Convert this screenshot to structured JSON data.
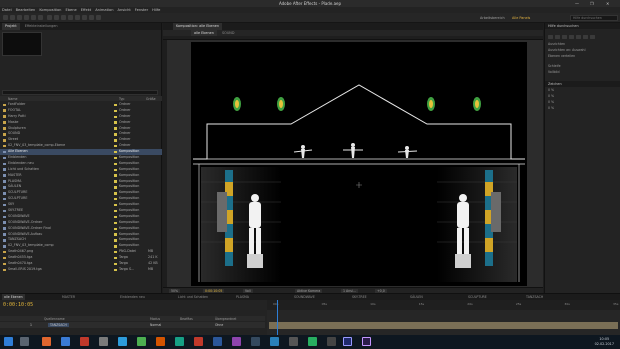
{
  "window": {
    "title": "Adobe After Effects - Plade.aep",
    "controls": [
      "—",
      "❐",
      "✕"
    ]
  },
  "menu": [
    "Datei",
    "Bearbeiten",
    "Komposition",
    "Ebene",
    "Effekt",
    "Animation",
    "Ansicht",
    "Fenster",
    "Hilfe"
  ],
  "toolbar": {
    "workspaces": [
      "Arbeitsbereich",
      "Alle Panels"
    ],
    "active_workspace": "Alle Panels",
    "search_placeholder": "Hilfe durchsuchen"
  },
  "project": {
    "tabs": [
      "Projekt",
      "Effekteinstellungen"
    ],
    "columns": {
      "name": "Name",
      "type": "Typ",
      "size": "Größe"
    },
    "items": [
      {
        "name": "FontFolder",
        "type": "Ordner",
        "size": "",
        "kind": "folder"
      },
      {
        "name": "FOOTAL",
        "type": "Ordner",
        "size": "",
        "kind": "folder"
      },
      {
        "name": "Harry Potti",
        "type": "Ordner",
        "size": "",
        "kind": "folder"
      },
      {
        "name": "Maske",
        "type": "Ordner",
        "size": "",
        "kind": "folder"
      },
      {
        "name": "Skulpturen",
        "type": "Ordner",
        "size": "",
        "kind": "folder"
      },
      {
        "name": "SOUND",
        "type": "Ordner",
        "size": "",
        "kind": "folder"
      },
      {
        "name": "Street",
        "type": "Ordner",
        "size": "",
        "kind": "folder"
      },
      {
        "name": "02_FNV_03_template_comp-Ebene",
        "type": "Ordner",
        "size": "",
        "kind": "folder"
      },
      {
        "name": "Alle Ebenen",
        "type": "Komposition",
        "size": "",
        "kind": "comp"
      },
      {
        "name": "Einblenden",
        "type": "Komposition",
        "size": "",
        "kind": "comp"
      },
      {
        "name": "Einblenden neu",
        "type": "Komposition",
        "size": "",
        "kind": "comp"
      },
      {
        "name": "Licht und Schatten",
        "type": "Komposition",
        "size": "",
        "kind": "comp"
      },
      {
        "name": "MASTER",
        "type": "Komposition",
        "size": "",
        "kind": "comp"
      },
      {
        "name": "PLASMA",
        "type": "Komposition",
        "size": "",
        "kind": "comp"
      },
      {
        "name": "SÄULEN",
        "type": "Komposition",
        "size": "",
        "kind": "comp"
      },
      {
        "name": "SCULPTURE",
        "type": "Komposition",
        "size": "",
        "kind": "comp"
      },
      {
        "name": "SCULPTURE",
        "type": "Komposition",
        "size": "",
        "kind": "comp"
      },
      {
        "name": "SKY",
        "type": "Komposition",
        "size": "",
        "kind": "comp"
      },
      {
        "name": "SKY-TREE",
        "type": "Komposition",
        "size": "",
        "kind": "comp"
      },
      {
        "name": "SOUNDWAVE",
        "type": "Komposition",
        "size": "",
        "kind": "comp"
      },
      {
        "name": "SOUNDWAVE-Ordner",
        "type": "Komposition",
        "size": "",
        "kind": "comp"
      },
      {
        "name": "SOUNDWAVE-Ordner Final",
        "type": "Komposition",
        "size": "",
        "kind": "comp"
      },
      {
        "name": "SOUNDWAVE-Aufbau",
        "type": "Komposition",
        "size": "",
        "kind": "comp"
      },
      {
        "name": "TANZSACH",
        "type": "Komposition",
        "size": "",
        "kind": "comp"
      },
      {
        "name": "02_FNV_03_template_comp",
        "type": "Komposition",
        "size": "",
        "kind": "comp"
      },
      {
        "name": "Seath0467.png",
        "type": "PNG-Datei",
        "size": "MB",
        "kind": "file"
      },
      {
        "name": "Seath0455.tga",
        "type": "Targa",
        "size": "241 K",
        "kind": "file"
      },
      {
        "name": "Seath0470.tga",
        "type": "Targa",
        "size": "42 KB",
        "kind": "file"
      },
      {
        "name": "Small-ERIS 2019.tga",
        "type": "Targa S...",
        "size": "MB",
        "kind": "file"
      }
    ],
    "selected_index": 8
  },
  "composition": {
    "panel_title": "Komposition: alle Ebenen",
    "tabs": [
      "alle Ebenen",
      "SOUND"
    ],
    "zoom": "50%",
    "timecode": "0:00:10:05",
    "resolution": "Voll",
    "camera": "Aktive Kamera",
    "views": "1 Ansi...",
    "offset": "+0,0"
  },
  "right_panels": {
    "top_title": "Hilfe durchsuchen",
    "info_rows": [
      "Ausrichten",
      "Ausrichten an: Auswahl",
      "Ebenen verteilen"
    ],
    "preview_title": "Vorschau",
    "preview_options": [
      "Schleife",
      "Vollbild"
    ],
    "character_title": "Zeichen",
    "character_values": [
      "0 %",
      "0 %",
      "0 %",
      "0 %"
    ]
  },
  "timeline": {
    "tabs": [
      "alle Ebenen",
      "MASTER",
      "Einblenden neu",
      "Licht und Schatten",
      "PLASMA",
      "SOUNDWAVE",
      "SKY-TREE",
      "SÄULEN",
      "SCULPTURE",
      "TANZSACH"
    ],
    "timecode": "0:00:10:05",
    "columns": {
      "name": "Quellenname",
      "mode": "Modus",
      "trkmat": "BewMas",
      "parent": "Übergeordnet"
    },
    "layer": {
      "index": "1",
      "name": "TANZSACH",
      "mode": "Normal",
      "parent": "Ohne"
    },
    "ruler_marks": [
      "00s",
      "05s",
      "10s",
      "15s",
      "20s",
      "25s",
      "30s",
      "35s"
    ]
  },
  "taskbar": {
    "time": "10:05",
    "date": "02.02.2017"
  },
  "colors": {
    "accent": "#e2b63a",
    "selection": "#3a4a62",
    "playhead": "#2e7fd6"
  }
}
